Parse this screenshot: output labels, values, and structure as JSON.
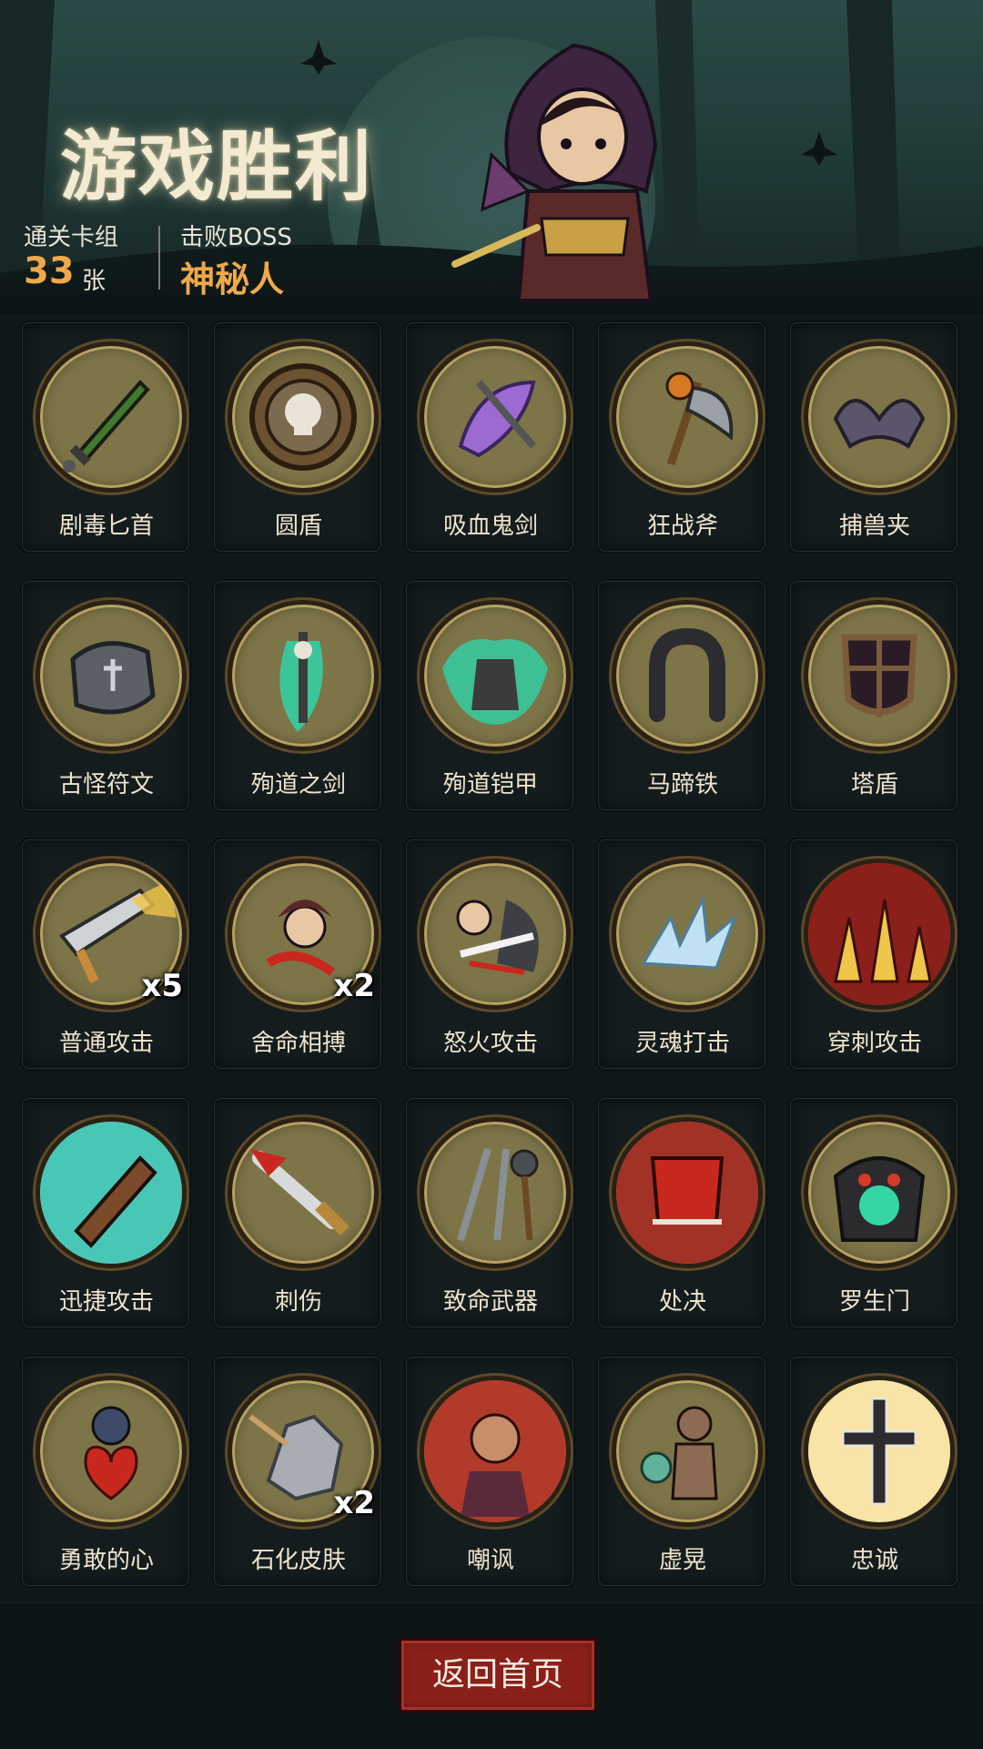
{
  "header": {
    "title": "游戏胜利",
    "cleared": {
      "label": "通关卡组",
      "value": "33",
      "unit": "张"
    },
    "boss": {
      "label": "击败BOSS",
      "name": "神秘人"
    }
  },
  "cards": [
    {
      "name": "剧毒匕首",
      "icon": "poison-dagger-icon",
      "count": ""
    },
    {
      "name": "圆盾",
      "icon": "round-shield-icon",
      "count": ""
    },
    {
      "name": "吸血鬼剑",
      "icon": "vampire-sword-icon",
      "count": ""
    },
    {
      "name": "狂战斧",
      "icon": "berserker-axe-icon",
      "count": ""
    },
    {
      "name": "捕兽夹",
      "icon": "bear-trap-icon",
      "count": ""
    },
    {
      "name": "古怪符文",
      "icon": "strange-rune-icon",
      "count": ""
    },
    {
      "name": "殉道之剑",
      "icon": "martyr-sword-icon",
      "count": ""
    },
    {
      "name": "殉道铠甲",
      "icon": "martyr-armor-icon",
      "count": ""
    },
    {
      "name": "马蹄铁",
      "icon": "horseshoe-icon",
      "count": ""
    },
    {
      "name": "塔盾",
      "icon": "tower-shield-icon",
      "count": ""
    },
    {
      "name": "普通攻击",
      "icon": "normal-attack-icon",
      "count": "x5"
    },
    {
      "name": "舍命相搏",
      "icon": "desperate-fight-icon",
      "count": "x2"
    },
    {
      "name": "怒火攻击",
      "icon": "rage-attack-icon",
      "count": ""
    },
    {
      "name": "灵魂打击",
      "icon": "soul-strike-icon",
      "count": ""
    },
    {
      "name": "穿刺攻击",
      "icon": "pierce-attack-icon",
      "count": ""
    },
    {
      "name": "迅捷攻击",
      "icon": "swift-attack-icon",
      "count": ""
    },
    {
      "name": "刺伤",
      "icon": "stab-icon",
      "count": ""
    },
    {
      "name": "致命武器",
      "icon": "deadly-weapons-icon",
      "count": ""
    },
    {
      "name": "处决",
      "icon": "execution-icon",
      "count": ""
    },
    {
      "name": "罗生门",
      "icon": "rashomon-icon",
      "count": ""
    },
    {
      "name": "勇敢的心",
      "icon": "brave-heart-icon",
      "count": ""
    },
    {
      "name": "石化皮肤",
      "icon": "stone-skin-icon",
      "count": "x2"
    },
    {
      "name": "嘲讽",
      "icon": "taunt-icon",
      "count": ""
    },
    {
      "name": "虚晃",
      "icon": "feint-icon",
      "count": ""
    },
    {
      "name": "忠诚",
      "icon": "loyalty-icon",
      "count": ""
    }
  ],
  "footer": {
    "home_button": "返回首页"
  },
  "colors": {
    "accent_gold": "#f0a94a",
    "button_red": "#8b1f1a",
    "medal": "#7d7548"
  }
}
